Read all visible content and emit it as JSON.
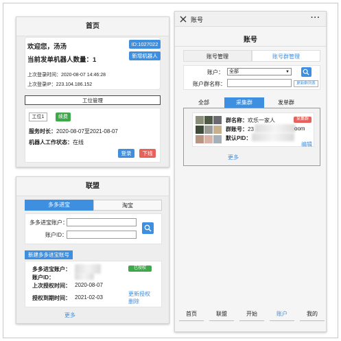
{
  "home": {
    "title": "首页",
    "welcome": "欢迎您，汤汤",
    "robot_count_label": "当前发单机器人数量：",
    "robot_count": "1",
    "id_badge": "ID:1027022",
    "add_robot_button": "新增机器人",
    "last_login_time_label": "上次登录时间：",
    "last_login_time": "2020-08-07 14:46:28",
    "last_login_ip_label": "上次登录IP：",
    "last_login_ip": "223.104.186.152",
    "station_manage_button": "工位管理",
    "station_tag": "工位1",
    "renew_button": "续费",
    "service_duration_label": "服务时长：",
    "service_duration": "2020-08-07至2021-08-07",
    "robot_status_label": "机器人工作状态：",
    "robot_status": "在线",
    "login_button": "登录",
    "logout_button": "下线"
  },
  "alliance": {
    "title": "联盟",
    "tabs": [
      "多多进宝",
      "淘宝"
    ],
    "account_label": "多多进宝账户：",
    "account_id_label": "账户ID：",
    "new_account_button": "新建多多进宝账号",
    "card": {
      "account_label": "多多进宝账户：",
      "account_id_label": "账户ID：",
      "status_badge": "已授权",
      "last_auth_label": "上次授权时间：",
      "last_auth_value": "2020-08-07",
      "auth_expire_label": "授权到期时间：",
      "auth_expire_value": "2021-02-03",
      "update_auth_link": "更新授权",
      "delete_link": "删除"
    },
    "more_link": "更多"
  },
  "account": {
    "topbar_title": "账号",
    "close_icon": "close-icon",
    "menu_icon": "more-dots-icon",
    "page_title": "账号",
    "segments": [
      "账号管理",
      "账号群管理"
    ],
    "active_segment": 1,
    "account_label": "账户：",
    "account_select_value": "全部",
    "group_name_label": "账户群名称：",
    "update_group_list_button": "更新群列表",
    "group_tabs": [
      "全部",
      "采集群",
      "发单群"
    ],
    "active_group_tab": 1,
    "group_card": {
      "name_label": "群名称：",
      "name_value": "欢乐一家人",
      "badge": "采集群",
      "number_label": "群账号：",
      "number_partial": "23",
      "number_suffix": "oom",
      "default_pid_label": "默认PID：",
      "edit_link": "编辑"
    },
    "more_link": "更多"
  },
  "bottom_nav": [
    "首页",
    "联盟",
    "开始",
    "账户",
    "我的"
  ],
  "active_nav": 3,
  "colors": {
    "primary": "#3e8fe0",
    "danger": "#e8605a",
    "success": "#3fa84a",
    "collect_badge": "#e8605a"
  }
}
